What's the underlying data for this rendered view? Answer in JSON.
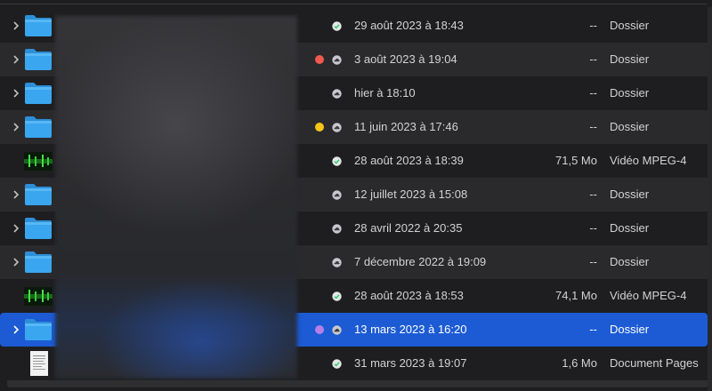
{
  "colors": {
    "background": "#1e1e20",
    "alt_row": "#2a2a2d",
    "selection": "#1c5bd4",
    "folder": "#3aa6f0",
    "tag_red": "#ee5a4f",
    "tag_yellow": "#f5c518",
    "tag_purple": "#b57ee8",
    "cloud_synced": "#2ecc71"
  },
  "rows": [
    {
      "expandable": true,
      "icon": "folder-icon",
      "tag": null,
      "status": "synced-check-icon",
      "date": "29 août 2023 à 18:43",
      "size": "--",
      "kind": "Dossier"
    },
    {
      "expandable": true,
      "icon": "folder-icon",
      "tag": "red",
      "status": "cloud-icon",
      "date": "3 août 2023 à 19:04",
      "size": "--",
      "kind": "Dossier"
    },
    {
      "expandable": true,
      "icon": "folder-icon",
      "tag": null,
      "status": "cloud-icon",
      "date": "hier à 18:10",
      "size": "--",
      "kind": "Dossier"
    },
    {
      "expandable": true,
      "icon": "folder-icon",
      "tag": "yellow",
      "status": "cloud-icon",
      "date": "11 juin 2023 à 17:46",
      "size": "--",
      "kind": "Dossier"
    },
    {
      "expandable": false,
      "icon": "video-thumbnail-icon",
      "tag": null,
      "status": "synced-check-icon",
      "date": "28 août 2023 à 18:39",
      "size": "71,5 Mo",
      "kind": "Vidéo MPEG-4"
    },
    {
      "expandable": true,
      "icon": "folder-icon",
      "tag": null,
      "status": "cloud-icon",
      "date": "12 juillet 2023 à 15:08",
      "size": "--",
      "kind": "Dossier"
    },
    {
      "expandable": true,
      "icon": "folder-icon",
      "tag": null,
      "status": "cloud-icon",
      "date": "28 avril 2022 à 20:35",
      "size": "--",
      "kind": "Dossier"
    },
    {
      "expandable": true,
      "icon": "folder-icon",
      "tag": null,
      "status": "cloud-icon",
      "date": "7 décembre 2022 à 19:09",
      "size": "--",
      "kind": "Dossier"
    },
    {
      "expandable": false,
      "icon": "video-thumbnail-icon",
      "tag": null,
      "status": "synced-check-icon",
      "date": "28 août 2023 à 18:53",
      "size": "74,1 Mo",
      "kind": "Vidéo MPEG-4"
    },
    {
      "expandable": true,
      "icon": "folder-icon",
      "tag": "purple",
      "status": "cloud-icon",
      "date": "13 mars 2023 à 16:20",
      "size": "--",
      "kind": "Dossier",
      "selected": true
    },
    {
      "expandable": false,
      "icon": "document-pages-icon",
      "tag": null,
      "status": "synced-check-icon",
      "date": "31 mars 2023 à 19:07",
      "size": "1,6 Mo",
      "kind": "Document Pages"
    }
  ]
}
